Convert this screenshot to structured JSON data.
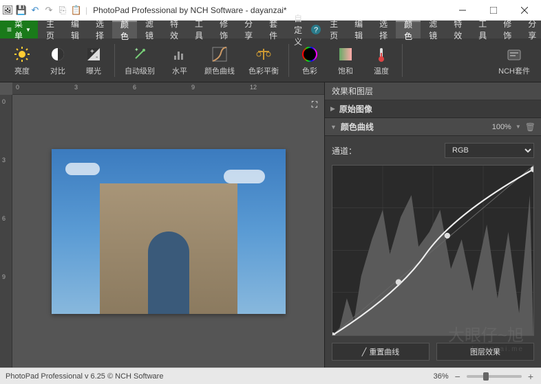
{
  "titlebar": {
    "title": "PhotoPad Professional by NCH Software - dayanzai*"
  },
  "menubar": {
    "menu_button": "菜单",
    "items": [
      "主页",
      "编辑",
      "选择",
      "颜色",
      "滤镜",
      "特效",
      "工具",
      "修饰",
      "分享",
      "套件",
      "自定义"
    ],
    "active_index": 3
  },
  "toolbar": {
    "items": [
      {
        "label": "亮度",
        "icon": "sun"
      },
      {
        "label": "对比",
        "icon": "contrast"
      },
      {
        "label": "曝光",
        "icon": "exposure"
      },
      {
        "label": "自动级别",
        "icon": "wand"
      },
      {
        "label": "水平",
        "icon": "levels"
      },
      {
        "label": "颜色曲线",
        "icon": "curves"
      },
      {
        "label": "色彩平衡",
        "icon": "balance"
      },
      {
        "label": "色彩",
        "icon": "hue"
      },
      {
        "label": "饱和",
        "icon": "saturation"
      },
      {
        "label": "温度",
        "icon": "thermometer"
      },
      {
        "label": "NCH套件",
        "icon": "suite"
      }
    ]
  },
  "ruler": {
    "h_ticks": [
      {
        "v": "0",
        "p": 5
      },
      {
        "v": "3",
        "p": 90
      },
      {
        "v": "6",
        "p": 175
      },
      {
        "v": "9",
        "p": 260
      },
      {
        "v": "12",
        "p": 345
      }
    ],
    "v_ticks": [
      {
        "v": "0",
        "p": 5
      },
      {
        "v": "3",
        "p": 90
      },
      {
        "v": "6",
        "p": 175
      },
      {
        "v": "9",
        "p": 260
      }
    ]
  },
  "panel": {
    "title": "效果和图层",
    "layers": [
      {
        "name": "原始图像",
        "expanded": false
      },
      {
        "name": "颜色曲线",
        "expanded": true,
        "opacity": "100%"
      }
    ],
    "channel_label": "通道：",
    "channel_value": "RGB",
    "reset_label": "重置曲线",
    "preview_label": "图层效果"
  },
  "statusbar": {
    "text": "PhotoPad Professional v 6.25 © NCH Software",
    "zoom": "36%"
  },
  "watermark": {
    "main": "大眼仔~旭",
    "sub": "dayanzai.me"
  }
}
